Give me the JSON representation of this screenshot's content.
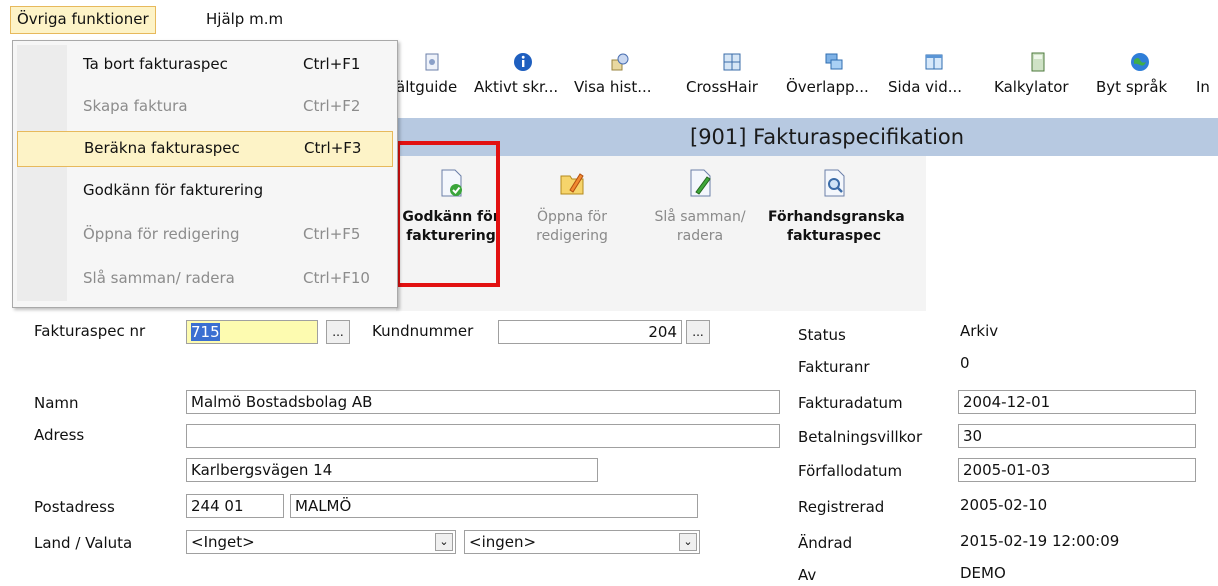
{
  "menubar": {
    "open_menu": "Övriga funktioner",
    "help": "Hjälp m.m"
  },
  "dropdown": {
    "items": [
      {
        "label": "Ta bort fakturaspec",
        "shortcut": "Ctrl+F1"
      },
      {
        "label": "Skapa faktura",
        "shortcut": "Ctrl+F2"
      },
      {
        "label": "Beräkna fakturaspec",
        "shortcut": "Ctrl+F3"
      },
      {
        "label": "Godkänn för fakturering",
        "shortcut": ""
      },
      {
        "label": "Öppna för redigering",
        "shortcut": "Ctrl+F5"
      },
      {
        "label": "Slå samman/ radera",
        "shortcut": "Ctrl+F10"
      }
    ]
  },
  "toolbar": {
    "items": [
      {
        "label": "ältguide",
        "icon": "document-icon"
      },
      {
        "label": "Aktivt skr...",
        "icon": "info-icon"
      },
      {
        "label": "Visa hist...",
        "icon": "history-icon"
      },
      {
        "label": "CrossHair",
        "icon": "crosshair-icon"
      },
      {
        "label": "Överlapp...",
        "icon": "overlap-icon"
      },
      {
        "label": "Sida vid...",
        "icon": "side-by-side-icon"
      },
      {
        "label": "Kalkylator",
        "icon": "calculator-icon"
      },
      {
        "label": "Byt språk",
        "icon": "globe-icon"
      },
      {
        "label": "In",
        "icon": ""
      }
    ]
  },
  "title": "[901]  Fakturaspecifikation",
  "actions": [
    {
      "label": "Godkänn för\nfakturering",
      "icon": "approve-document-icon"
    },
    {
      "label": "Öppna för\nredigering",
      "icon": "edit-folder-icon"
    },
    {
      "label": "Slå samman/\nradera",
      "icon": "merge-document-icon"
    },
    {
      "label": "Förhandsgranska\nfakturaspec",
      "icon": "preview-icon"
    }
  ],
  "form": {
    "fakturaspec_label": "Fakturaspec nr",
    "fakturaspec_value": "715",
    "kundnummer_label": "Kundnummer",
    "kundnummer_value": "204",
    "namn_label": "Namn",
    "namn_value": "Malmö Bostadsbolag AB",
    "adress_label": "Adress",
    "adress_value1": "",
    "adress_value2": "Karlbergsvägen 14",
    "postadress_label": "Postadress",
    "postnr_value": "244 01",
    "ort_value": "MALMÖ",
    "land_label": "Land / Valuta",
    "land_value": "<Inget>",
    "valuta_value": "<ingen>",
    "browse": "..."
  },
  "status": {
    "status_label": "Status",
    "status_value": "Arkiv",
    "fakturanr_label": "Fakturanr",
    "fakturanr_value": "0",
    "fakturadatum_label": "Fakturadatum",
    "fakturadatum_value": "2004-12-01",
    "betalningsvillkor_label": "Betalningsvillkor",
    "betalningsvillkor_value": "30",
    "forfallodatum_label": "Förfallodatum",
    "forfallodatum_value": "2005-01-03",
    "registrerad_label": "Registrerad",
    "registrerad_value": "2005-02-10",
    "andrad_label": "Ändrad",
    "andrad_value": "2015-02-19 12:00:09",
    "av_label": "Av",
    "av_value": "DEMO"
  }
}
